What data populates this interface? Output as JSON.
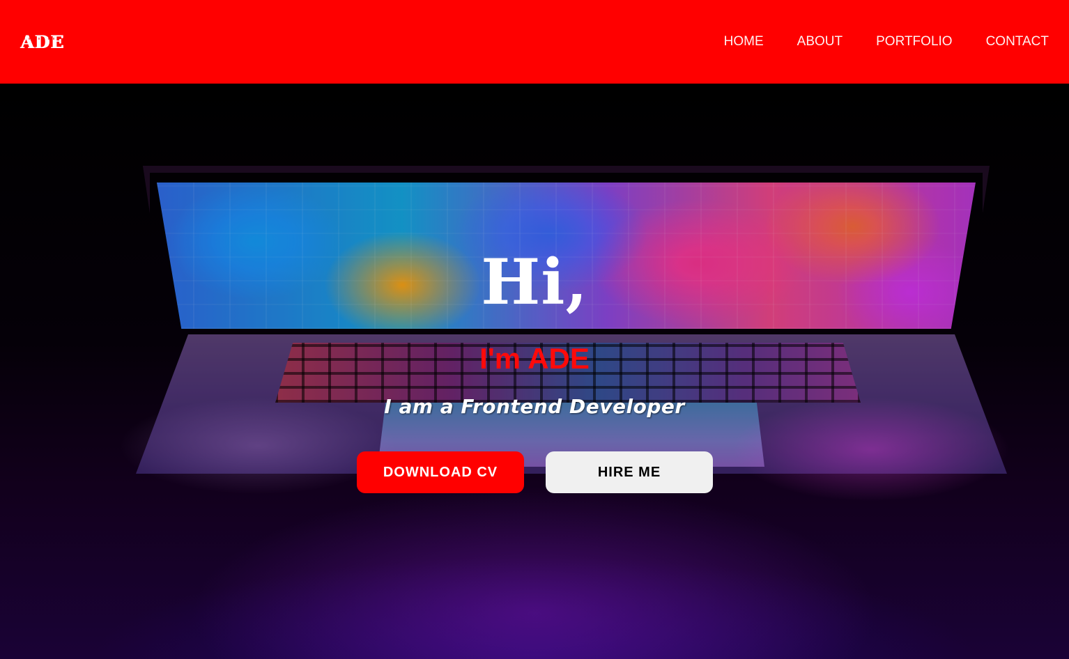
{
  "header": {
    "logo_text": "ADE",
    "nav": [
      {
        "label": "HOME"
      },
      {
        "label": "ABOUT"
      },
      {
        "label": "PORTFOLIO"
      },
      {
        "label": "CONTACT"
      }
    ]
  },
  "hero": {
    "greeting": "Hi,",
    "name": "I'm ADE",
    "role": "I am a Frontend Developer",
    "buttons": {
      "primary": "DOWNLOAD CV",
      "secondary": "HIRE ME"
    }
  },
  "colors": {
    "brand_red": "#ff0000",
    "text_white": "#ffffff",
    "button_light": "#f0f0f0"
  }
}
